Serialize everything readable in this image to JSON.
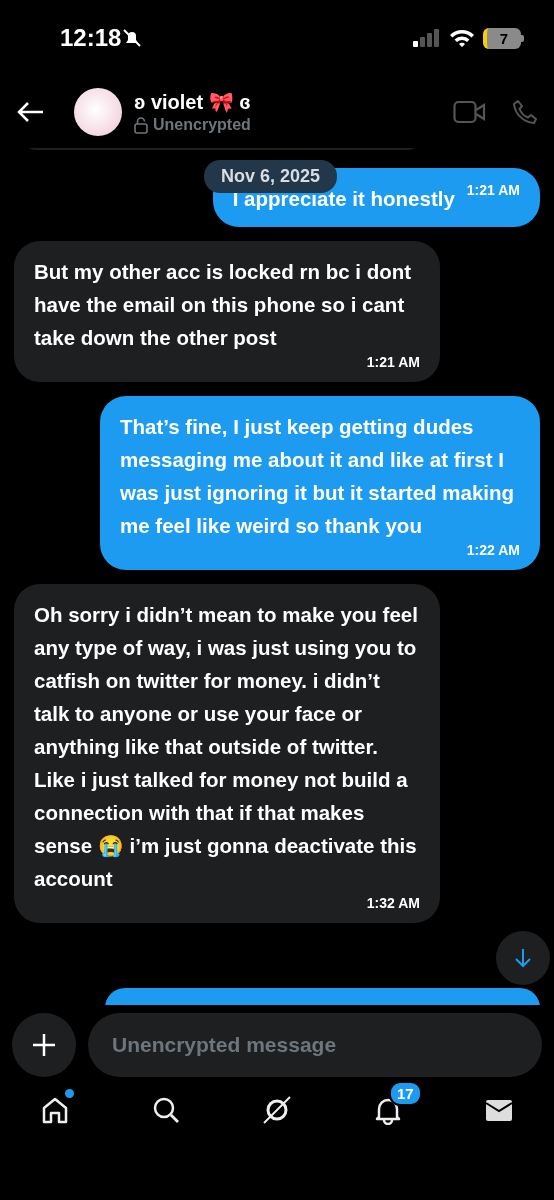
{
  "status_bar": {
    "time": "12:18",
    "battery": "7"
  },
  "header": {
    "name": "ʚ violet 🎀 ɞ",
    "subtitle": "Unencrypted"
  },
  "date_divider": "Nov 6, 2025",
  "messages": [
    {
      "kind": "sent",
      "text": "I appreciate it honestly",
      "time": "1:21 AM"
    },
    {
      "kind": "received",
      "text": "But my other acc is locked rn bc i dont have the email on this phone so i cant take down the other post",
      "time": "1:21 AM"
    },
    {
      "kind": "sent",
      "text": "That’s fine, I just keep getting dudes messaging me about it and like at first I was just ignoring it but it started making me feel like weird so thank you",
      "time": "1:22 AM"
    },
    {
      "kind": "received",
      "text": "Oh sorry i didn’t mean to make you feel any type of way, i was just using you to catfish on twitter for money. i didn’t talk to anyone or use your face or anything like that outside of twitter. Like i just talked for money not build a connection with that if that makes sense 😭 i’m just gonna deactivate this account",
      "time": "1:32 AM"
    }
  ],
  "composer": {
    "placeholder": "Unencrypted message"
  },
  "nav": [
    {
      "kind": "home",
      "dot": true
    },
    {
      "kind": "search"
    },
    {
      "kind": "grok"
    },
    {
      "kind": "bell",
      "badge": "17"
    },
    {
      "kind": "mail"
    }
  ]
}
